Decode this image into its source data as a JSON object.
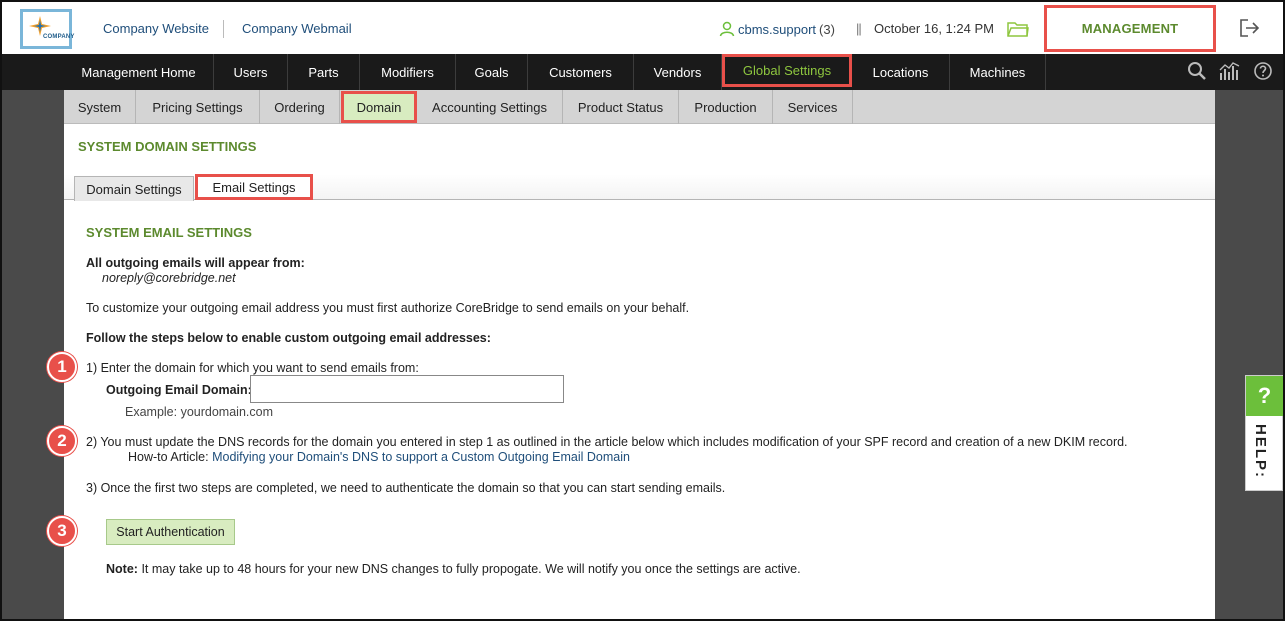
{
  "header": {
    "logo_text": "COMPANY",
    "links": [
      "Company Website",
      "Company Webmail"
    ],
    "user_name": "cbms.support",
    "user_count": "(3)",
    "date_separator": "||",
    "datetime": "October 16, 1:24 PM",
    "management_label": "MANAGEMENT"
  },
  "main_nav": [
    "Management Home",
    "Users",
    "Parts",
    "Modifiers",
    "Goals",
    "Customers",
    "Vendors",
    "Global Settings",
    "Locations",
    "Machines"
  ],
  "sub_nav": [
    "System",
    "Pricing Settings",
    "Ordering",
    "Domain",
    "Accounting Settings",
    "Product Status",
    "Production",
    "Services"
  ],
  "page": {
    "title": "SYSTEM DOMAIN SETTINGS",
    "tabs": [
      "Domain Settings",
      "Email Settings"
    ],
    "section_title": "SYSTEM EMAIL SETTINGS",
    "from_label": "All outgoing emails will appear from:",
    "from_address": "noreply@corebridge.net",
    "intro": "To customize your outgoing email address you must first authorize CoreBridge to send emails on your behalf.",
    "steps_heading": "Follow the steps below to enable custom outgoing email addresses:",
    "step1": "1) Enter the domain for which you want to send emails from:",
    "domain_label": "Outgoing Email Domain:",
    "domain_value": "",
    "example": "Example: yourdomain.com",
    "step2": "2) You must update the DNS records for the domain you entered in step 1 as outlined in the article below which includes modification of your SPF record and creation of a new DKIM record.",
    "howto_label": "How-to Article:",
    "howto_link": "Modifying your Domain's DNS to support a Custom Outgoing Email Domain",
    "step3": "3) Once the first two steps are completed, we need to authenticate the domain so that you can start sending emails.",
    "auth_button": "Start Authentication",
    "note_label": "Note:",
    "note_text": "It may take up to 48 hours for your new DNS changes to fully propogate. We will notify you once the settings are active."
  },
  "badges": [
    "1",
    "2",
    "3"
  ],
  "help": {
    "symbol": "?",
    "label": "HELP:"
  },
  "colors": {
    "accent_green": "#5c8a2e",
    "highlight_red": "#e8504a",
    "nav_bg": "#1a1a1a",
    "active_tab_bg": "#d8ecc0"
  }
}
